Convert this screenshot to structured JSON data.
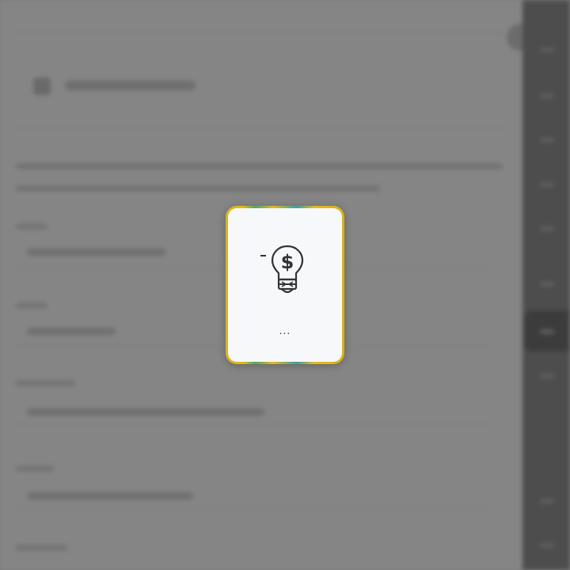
{
  "dialog": {
    "icon": "idea-money-lightbulb-icon",
    "collapse_icon": "minus-icon",
    "loading_text": "...",
    "border_colors": [
      "#d8b51c",
      "#4fa56a",
      "#3aa0a0"
    ]
  },
  "background": {
    "main_color": "#858585",
    "rail_color": "#4d4d4d",
    "blurred": true
  }
}
